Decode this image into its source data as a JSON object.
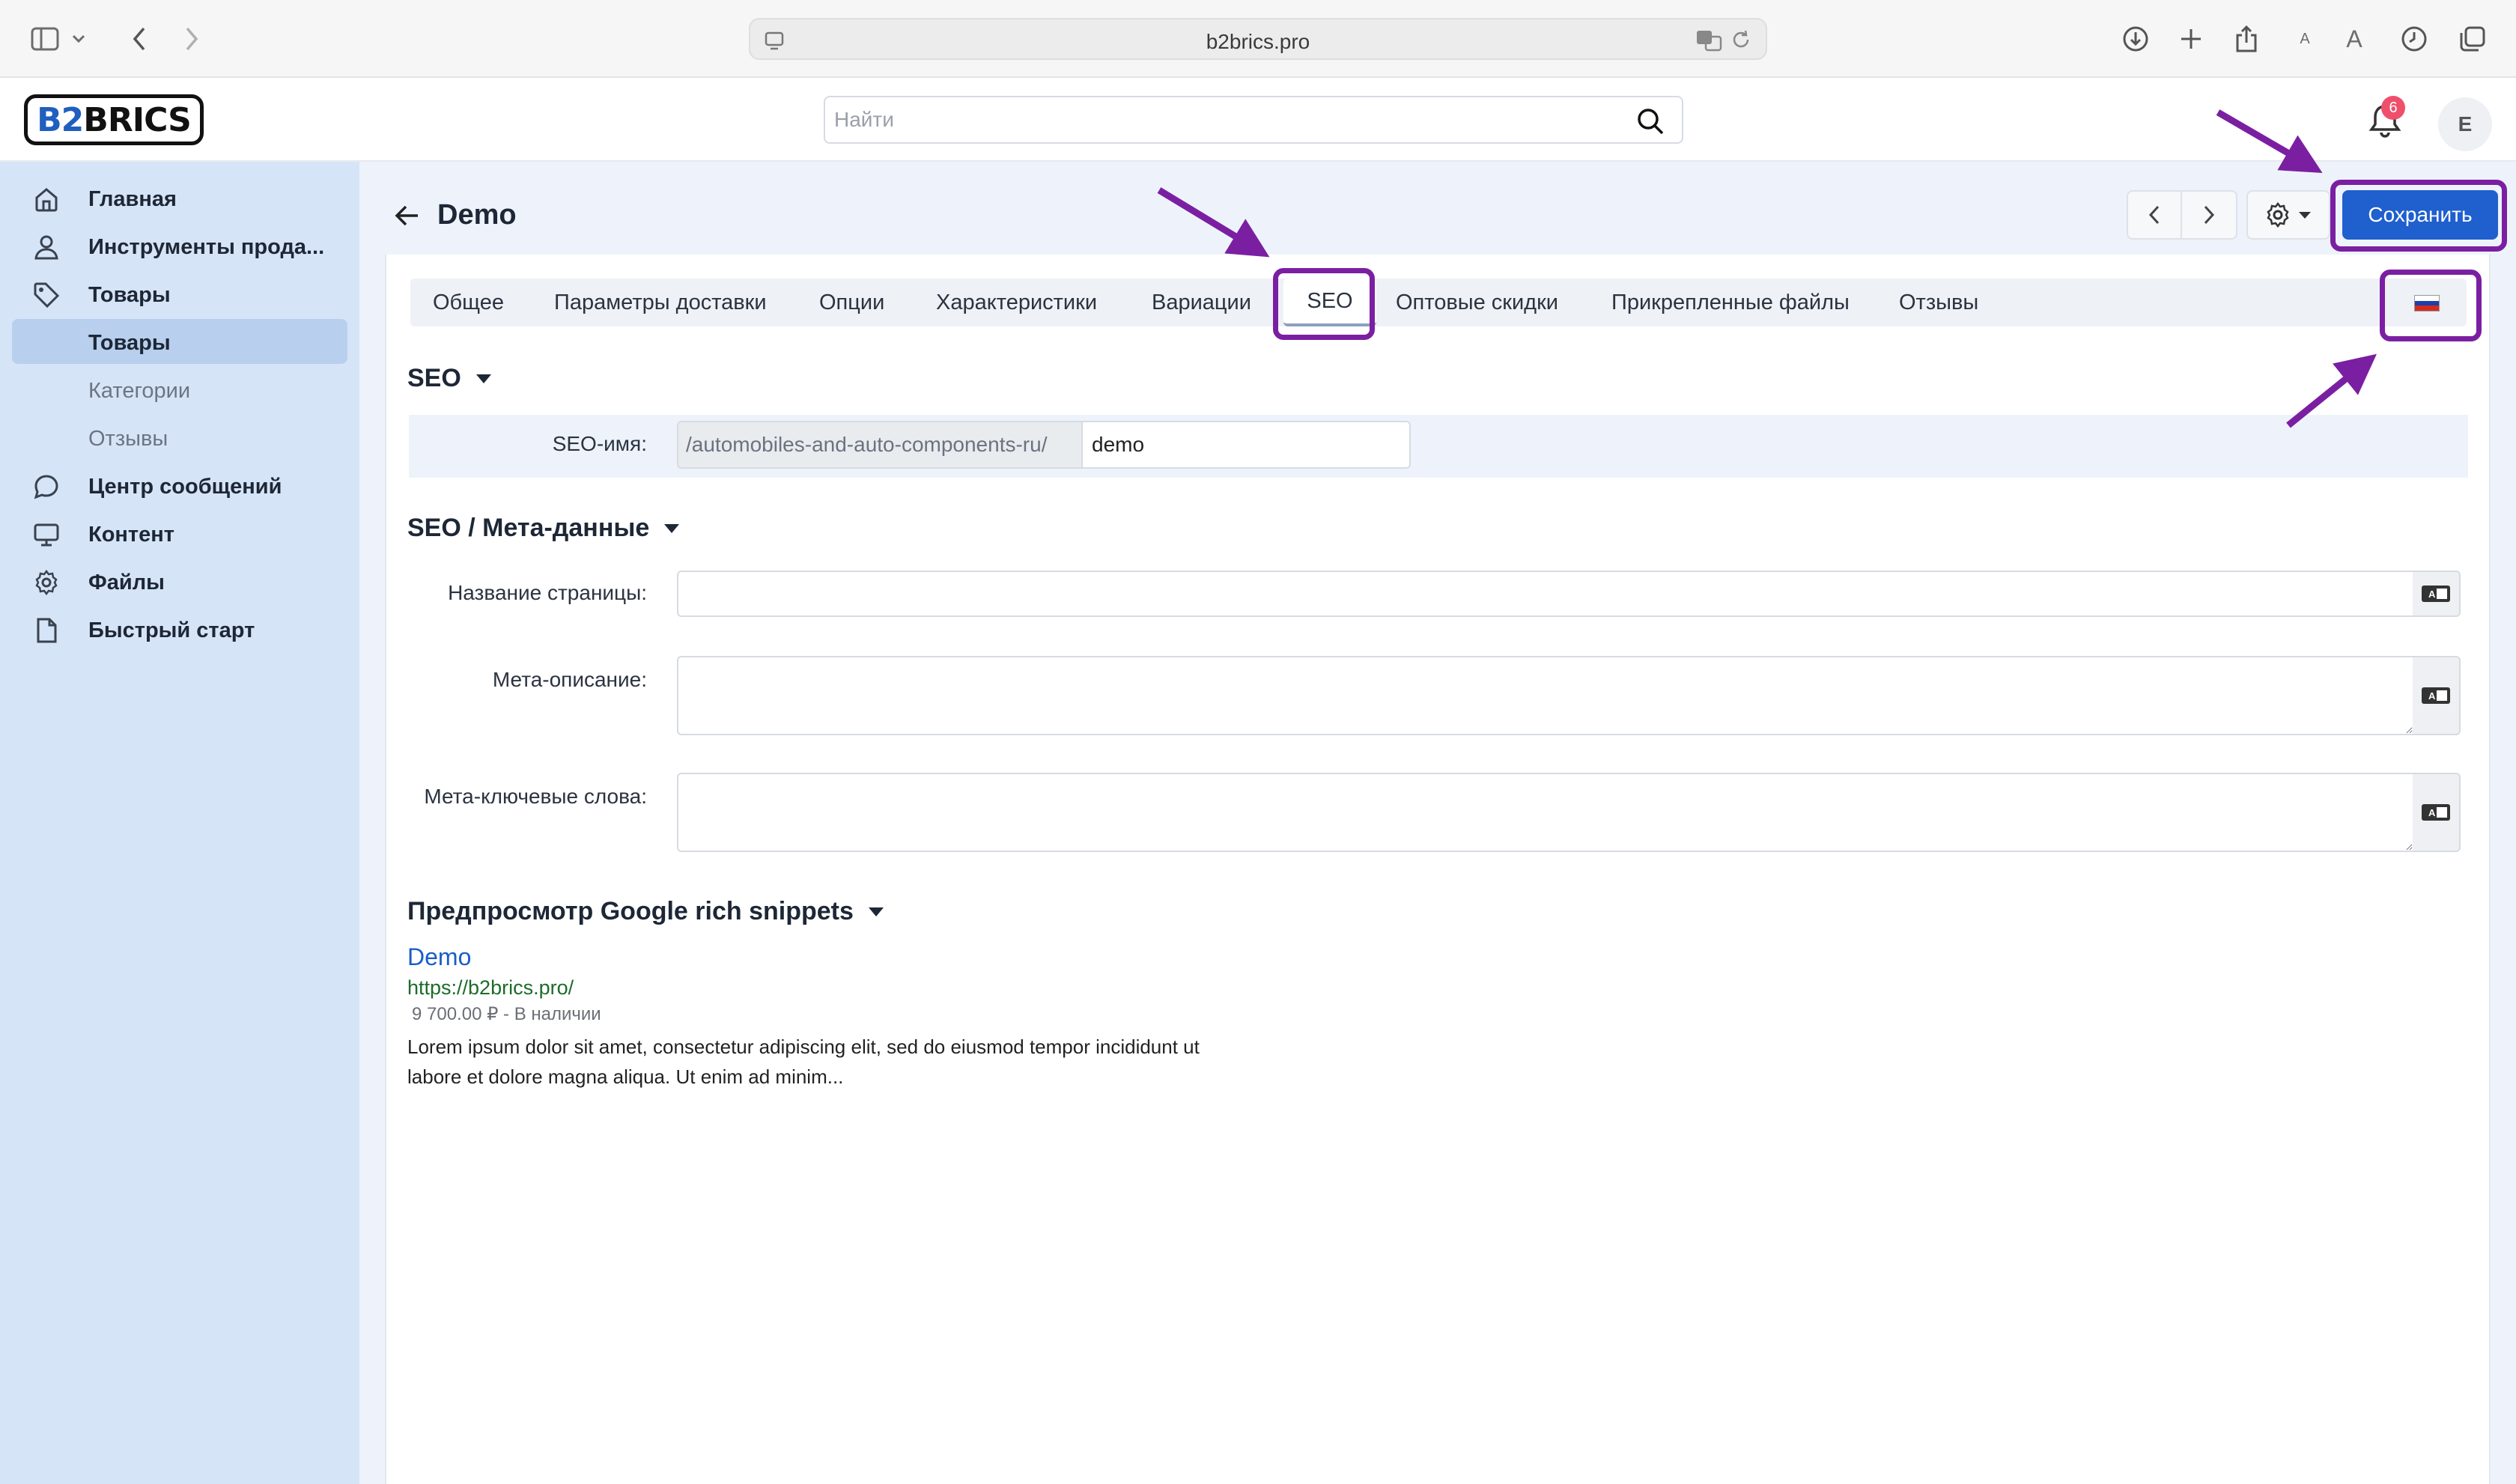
{
  "browser": {
    "url": "b2brics.pro"
  },
  "header": {
    "logo_part1": "B2",
    "logo_part2": "BRICS",
    "search_placeholder": "Найти",
    "notifications_count": "6",
    "avatar_initial": "E"
  },
  "sidebar": {
    "items": [
      {
        "label": "Главная",
        "icon": "home-icon"
      },
      {
        "label": "Инструменты прода...",
        "icon": "user-icon"
      },
      {
        "label": "Товары",
        "icon": "tag-icon"
      },
      {
        "label": "Товары",
        "icon": ""
      },
      {
        "label": "Категории",
        "icon": ""
      },
      {
        "label": "Отзывы",
        "icon": ""
      },
      {
        "label": "Центр сообщений",
        "icon": "chat-icon"
      },
      {
        "label": "Контент",
        "icon": "monitor-icon"
      },
      {
        "label": "Файлы",
        "icon": "gear-icon"
      },
      {
        "label": "Быстрый старт",
        "icon": "document-icon"
      }
    ],
    "active_index": 3
  },
  "page": {
    "title": "Demo",
    "save_label": "Сохранить"
  },
  "tabs": [
    "Общее",
    "Параметры доставки",
    "Опции",
    "Характеристики",
    "Вариации",
    "SEO",
    "Оптовые скидки",
    "Прикрепленные файлы",
    "Отзывы"
  ],
  "active_tab": "SEO",
  "seo": {
    "heading": "SEO",
    "name_label": "SEO-имя:",
    "prefix": "/automobiles-and-auto-components-ru/",
    "slug": "demo"
  },
  "meta": {
    "heading": "SEO / Мета-данные",
    "page_title_label": "Название страницы:",
    "description_label": "Мета-описание:",
    "keywords_label": "Мета-ключевые слова:",
    "page_title_value": "",
    "description_value": "",
    "keywords_value": ""
  },
  "snippet": {
    "heading": "Предпросмотр Google rich snippets",
    "title": "Demo",
    "url": "https://b2brics.pro/",
    "price": "9 700.00 ₽ - В наличии",
    "description": "Lorem ipsum dolor sit amet, consectetur adipiscing elit, sed do eiusmod tempor incididunt ut labore et dolore magna aliqua. Ut enim ad minim..."
  },
  "colors": {
    "accent": "#1f5fce",
    "annotation": "#7b1fa2",
    "sidebar_bg": "#d6e4f7",
    "badge": "#ef4f6b",
    "flag": [
      "#ffffff",
      "#1c3faa",
      "#d52b1e"
    ]
  }
}
